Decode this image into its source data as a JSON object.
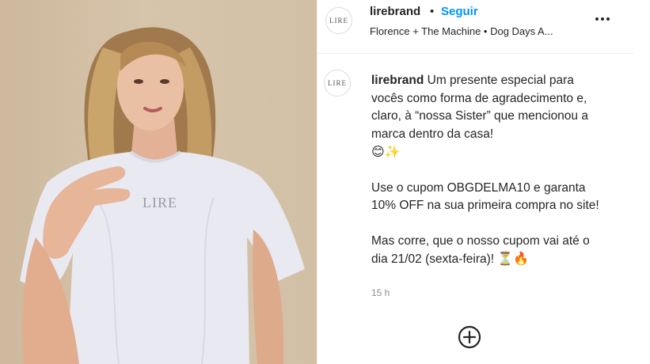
{
  "post": {
    "username": "lirebrand",
    "separator": "•",
    "follow_label": "Seguir",
    "audio": "Florence + The Machine • Dog Days A...",
    "avatar_text": "LIRE",
    "shirt_logo": "LIRE"
  },
  "caption": {
    "username": "lirebrand",
    "line1": "Um presente especial para vocês como forma de agradecimento e, claro, à “nossa Sister” que mencionou a marca dentro da casa!",
    "emoji1": "😊✨",
    "line2": "Use o cupom OBGDELMA10 e garanta 10% OFF na sua primeira compra no site!",
    "line3": "Mas corre, que o nosso cupom vai até o dia 21/02 (sexta-feira)!",
    "emoji3": "⏳🔥",
    "time": "15 h"
  },
  "colors": {
    "follow": "#0095f6",
    "text": "#262626",
    "muted": "#8e8e8e"
  }
}
